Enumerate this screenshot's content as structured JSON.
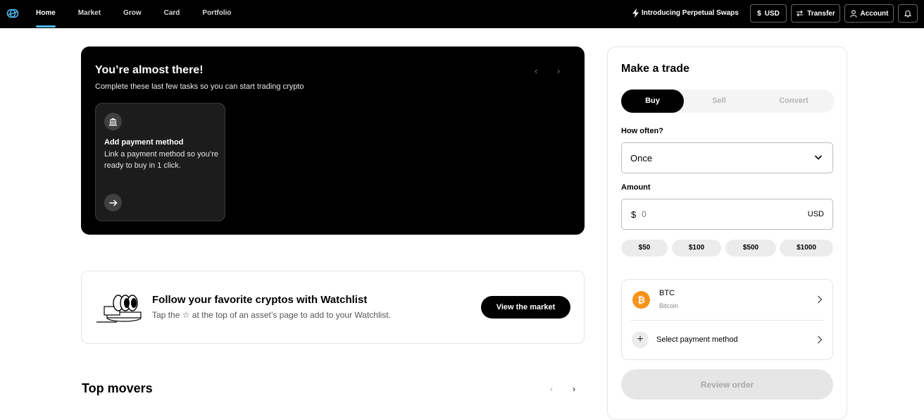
{
  "nav": {
    "items": [
      {
        "label": "Home",
        "active": true
      },
      {
        "label": "Market"
      },
      {
        "label": "Grow"
      },
      {
        "label": "Card"
      },
      {
        "label": "Portfolio"
      }
    ],
    "promo": "Introducing Perpetual Swaps",
    "currency_label": "USD",
    "currency_symbol": "$",
    "transfer_label": "Transfer",
    "account_label": "Account"
  },
  "hero": {
    "title": "You’re almost there!",
    "subtitle": "Complete these last few tasks so you can start trading crypto",
    "prev_arrow": "‹",
    "next_arrow": "›",
    "task": {
      "title": "Add payment method",
      "description": "Link a payment method so you’re ready to buy in 1 click.",
      "icon": "bank-icon",
      "go_icon": "arrow-right-icon"
    }
  },
  "watchlist": {
    "title": "Follow your favorite cryptos with Watchlist",
    "subtitle": "Tap the ☆ at the top of an asset’s page to add to your Watchlist.",
    "button_label": "View the market"
  },
  "top_movers": {
    "title": "Top movers",
    "prev_arrow": "‹",
    "next_arrow": "›"
  },
  "trade": {
    "title": "Make a trade",
    "tabs": [
      {
        "label": "Buy",
        "active": true
      },
      {
        "label": "Sell"
      },
      {
        "label": "Convert"
      }
    ],
    "frequency_label": "How often?",
    "frequency_value": "Once",
    "amount_label": "Amount",
    "amount_symbol": "$",
    "amount_placeholder": "0",
    "amount_currency": "USD",
    "quick_amounts": [
      "$50",
      "$100",
      "$500",
      "$1000"
    ],
    "asset": {
      "symbol": "BTC",
      "name": "Bitcoin",
      "icon_glyph": "₿"
    },
    "payment_label": "Select payment method",
    "review_label": "Review order"
  },
  "colors": {
    "accent": "#4fb4e8",
    "bitcoin": "#f7931a",
    "topbar": "#000000"
  }
}
